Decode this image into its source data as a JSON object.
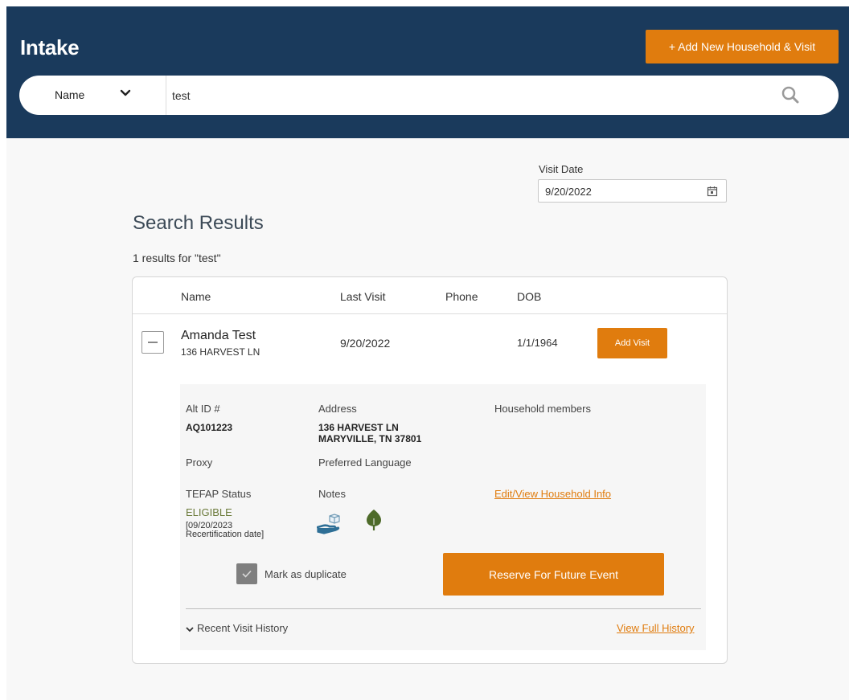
{
  "header": {
    "title": "Intake",
    "add_button_label": "+ Add New Household & Visit",
    "background_color": "#1a3a5c",
    "accent_color": "#e07c0e"
  },
  "search": {
    "type_selected": "Name",
    "query": "test",
    "icons": [
      "chevron-down-icon",
      "search-icon"
    ]
  },
  "visit_date": {
    "label": "Visit Date",
    "value": "9/20/2022",
    "icon": "calendar-icon"
  },
  "results": {
    "title": "Search Results",
    "count_text": "1 results for \"test\"",
    "columns": [
      "Name",
      "Last Visit",
      "Phone",
      "DOB"
    ],
    "rows": [
      {
        "name": "Amanda Test",
        "address": "136 HARVEST LN",
        "last_visit": "9/20/2022",
        "phone": "",
        "dob": "1/1/1964",
        "action_label": "Add Visit",
        "details": {
          "alt_id_label": "Alt ID #",
          "alt_id_value": "AQ101223",
          "address_label": "Address",
          "address_line1": "136 HARVEST LN",
          "address_line2": "MARYVILLE, TN 37801",
          "household_label": "Household members",
          "proxy_label": "Proxy",
          "language_label": "Preferred Language",
          "tefap_label": "TEFAP Status",
          "tefap_value": "ELIGIBLE",
          "recert_line1": "[09/20/2023",
          "recert_line2": "Recertification date]",
          "notes_label": "Notes",
          "notes_icons": [
            "hand-box-icon",
            "leaf-icon"
          ],
          "edit_link": "Edit/View Household Info",
          "duplicate_label": "Mark as duplicate",
          "duplicate_checked": true,
          "reserve_label": "Reserve For Future Event",
          "history_label": "Recent Visit History",
          "full_history_link": "View Full History"
        }
      }
    ]
  }
}
